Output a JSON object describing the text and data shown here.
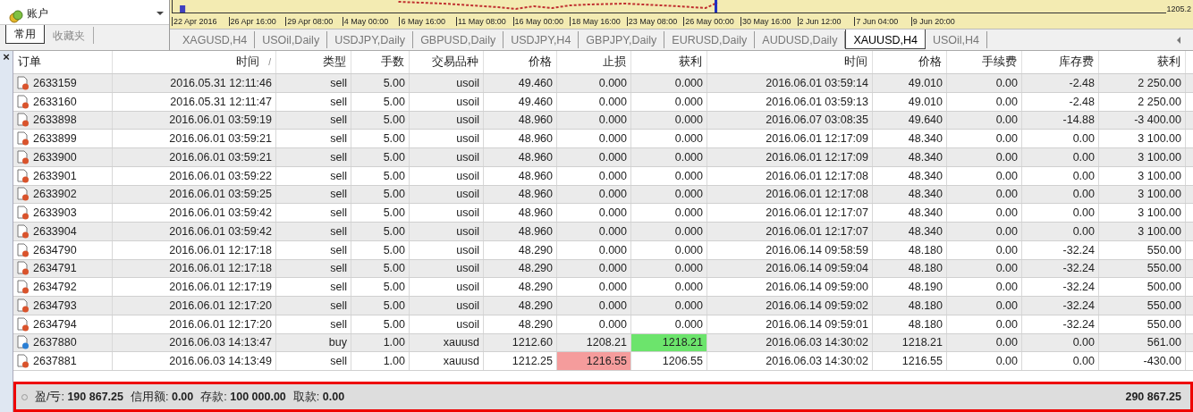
{
  "navigator": {
    "tree_item": "账户",
    "tabs": [
      {
        "label": "常用",
        "selected": true
      },
      {
        "label": "收藏夹",
        "selected": false
      }
    ]
  },
  "chart": {
    "x_labels": [
      "22 Apr 2016",
      "26 Apr 16:00",
      "29 Apr 08:00",
      "4 May 00:00",
      "6 May 16:00",
      "11 May 08:00",
      "16 May 00:00",
      "18 May 16:00",
      "23 May 08:00",
      "26 May 00:00",
      "30 May 16:00",
      "2 Jun 12:00",
      "7 Jun 04:00",
      "9 Jun 20:00"
    ],
    "price_label": "1205.2"
  },
  "chart_tabs": [
    {
      "label": "XAGUSD,H4",
      "selected": false
    },
    {
      "label": "USOil,Daily",
      "selected": false
    },
    {
      "label": "USDJPY,Daily",
      "selected": false
    },
    {
      "label": "GBPUSD,Daily",
      "selected": false
    },
    {
      "label": "USDJPY,H4",
      "selected": false
    },
    {
      "label": "GBPJPY,Daily",
      "selected": false
    },
    {
      "label": "EURUSD,Daily",
      "selected": false
    },
    {
      "label": "AUDUSD,Daily",
      "selected": false
    },
    {
      "label": "XAUUSD,H4",
      "selected": true
    },
    {
      "label": "USOil,H4",
      "selected": false
    }
  ],
  "close_glyph": "×",
  "table": {
    "columns": [
      "订单",
      "时间",
      "类型",
      "手数",
      "交易品种",
      "价格",
      "止损",
      "获利",
      "时间",
      "价格",
      "手续费",
      "库存费",
      "获利"
    ],
    "sort_mark": "/",
    "rows": [
      {
        "kind": "sell",
        "sl_hit": false,
        "tp_hit": false,
        "cells": [
          "2633159",
          "2016.05.31 12:11:46",
          "sell",
          "5.00",
          "usoil",
          "49.460",
          "0.000",
          "0.000",
          "2016.06.01 03:59:14",
          "49.010",
          "0.00",
          "-2.48",
          "2 250.00"
        ]
      },
      {
        "kind": "sell",
        "sl_hit": false,
        "tp_hit": false,
        "cells": [
          "2633160",
          "2016.05.31 12:11:47",
          "sell",
          "5.00",
          "usoil",
          "49.460",
          "0.000",
          "0.000",
          "2016.06.01 03:59:13",
          "49.010",
          "0.00",
          "-2.48",
          "2 250.00"
        ]
      },
      {
        "kind": "sell",
        "sl_hit": false,
        "tp_hit": false,
        "cells": [
          "2633898",
          "2016.06.01 03:59:19",
          "sell",
          "5.00",
          "usoil",
          "48.960",
          "0.000",
          "0.000",
          "2016.06.07 03:08:35",
          "49.640",
          "0.00",
          "-14.88",
          "-3 400.00"
        ]
      },
      {
        "kind": "sell",
        "sl_hit": false,
        "tp_hit": false,
        "cells": [
          "2633899",
          "2016.06.01 03:59:21",
          "sell",
          "5.00",
          "usoil",
          "48.960",
          "0.000",
          "0.000",
          "2016.06.01 12:17:09",
          "48.340",
          "0.00",
          "0.00",
          "3 100.00"
        ]
      },
      {
        "kind": "sell",
        "sl_hit": false,
        "tp_hit": false,
        "cells": [
          "2633900",
          "2016.06.01 03:59:21",
          "sell",
          "5.00",
          "usoil",
          "48.960",
          "0.000",
          "0.000",
          "2016.06.01 12:17:09",
          "48.340",
          "0.00",
          "0.00",
          "3 100.00"
        ]
      },
      {
        "kind": "sell",
        "sl_hit": false,
        "tp_hit": false,
        "cells": [
          "2633901",
          "2016.06.01 03:59:22",
          "sell",
          "5.00",
          "usoil",
          "48.960",
          "0.000",
          "0.000",
          "2016.06.01 12:17:08",
          "48.340",
          "0.00",
          "0.00",
          "3 100.00"
        ]
      },
      {
        "kind": "sell",
        "sl_hit": false,
        "tp_hit": false,
        "cells": [
          "2633902",
          "2016.06.01 03:59:25",
          "sell",
          "5.00",
          "usoil",
          "48.960",
          "0.000",
          "0.000",
          "2016.06.01 12:17:08",
          "48.340",
          "0.00",
          "0.00",
          "3 100.00"
        ]
      },
      {
        "kind": "sell",
        "sl_hit": false,
        "tp_hit": false,
        "cells": [
          "2633903",
          "2016.06.01 03:59:42",
          "sell",
          "5.00",
          "usoil",
          "48.960",
          "0.000",
          "0.000",
          "2016.06.01 12:17:07",
          "48.340",
          "0.00",
          "0.00",
          "3 100.00"
        ]
      },
      {
        "kind": "sell",
        "sl_hit": false,
        "tp_hit": false,
        "cells": [
          "2633904",
          "2016.06.01 03:59:42",
          "sell",
          "5.00",
          "usoil",
          "48.960",
          "0.000",
          "0.000",
          "2016.06.01 12:17:07",
          "48.340",
          "0.00",
          "0.00",
          "3 100.00"
        ]
      },
      {
        "kind": "sell",
        "sl_hit": false,
        "tp_hit": false,
        "cells": [
          "2634790",
          "2016.06.01 12:17:18",
          "sell",
          "5.00",
          "usoil",
          "48.290",
          "0.000",
          "0.000",
          "2016.06.14 09:58:59",
          "48.180",
          "0.00",
          "-32.24",
          "550.00"
        ]
      },
      {
        "kind": "sell",
        "sl_hit": false,
        "tp_hit": false,
        "cells": [
          "2634791",
          "2016.06.01 12:17:18",
          "sell",
          "5.00",
          "usoil",
          "48.290",
          "0.000",
          "0.000",
          "2016.06.14 09:59:04",
          "48.180",
          "0.00",
          "-32.24",
          "550.00"
        ]
      },
      {
        "kind": "sell",
        "sl_hit": false,
        "tp_hit": false,
        "cells": [
          "2634792",
          "2016.06.01 12:17:19",
          "sell",
          "5.00",
          "usoil",
          "48.290",
          "0.000",
          "0.000",
          "2016.06.14 09:59:00",
          "48.190",
          "0.00",
          "-32.24",
          "500.00"
        ]
      },
      {
        "kind": "sell",
        "sl_hit": false,
        "tp_hit": false,
        "cells": [
          "2634793",
          "2016.06.01 12:17:20",
          "sell",
          "5.00",
          "usoil",
          "48.290",
          "0.000",
          "0.000",
          "2016.06.14 09:59:02",
          "48.180",
          "0.00",
          "-32.24",
          "550.00"
        ]
      },
      {
        "kind": "sell",
        "sl_hit": false,
        "tp_hit": false,
        "cells": [
          "2634794",
          "2016.06.01 12:17:20",
          "sell",
          "5.00",
          "usoil",
          "48.290",
          "0.000",
          "0.000",
          "2016.06.14 09:59:01",
          "48.180",
          "0.00",
          "-32.24",
          "550.00"
        ]
      },
      {
        "kind": "buy",
        "sl_hit": false,
        "tp_hit": true,
        "cells": [
          "2637880",
          "2016.06.03 14:13:47",
          "buy",
          "1.00",
          "xauusd",
          "1212.60",
          "1208.21",
          "1218.21",
          "2016.06.03 14:30:02",
          "1218.21",
          "0.00",
          "0.00",
          "561.00"
        ]
      },
      {
        "kind": "sell",
        "sl_hit": true,
        "tp_hit": false,
        "cells": [
          "2637881",
          "2016.06.03 14:13:49",
          "sell",
          "1.00",
          "xauusd",
          "1212.25",
          "1216.55",
          "1206.55",
          "2016.06.03 14:30:02",
          "1216.55",
          "0.00",
          "0.00",
          "-430.00"
        ]
      }
    ]
  },
  "summary": {
    "items": [
      {
        "label": "盈/亏:",
        "value": "190 867.25"
      },
      {
        "label": "信用额:",
        "value": "0.00"
      },
      {
        "label": "存款:",
        "value": "100 000.00"
      },
      {
        "label": "取款:",
        "value": "0.00"
      }
    ],
    "total": "290 867.25"
  }
}
